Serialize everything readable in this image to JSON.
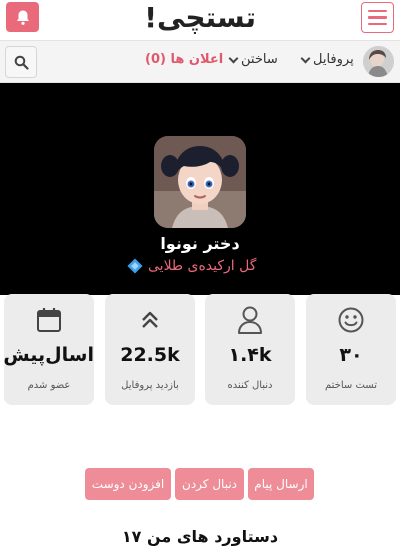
{
  "header": {
    "logo_text": "تستچی!",
    "bell_icon": "bell-icon",
    "menu_icon": "hamburger-icon",
    "accent_color": "#e96a7b"
  },
  "nav": {
    "profile_label": "پروفایل",
    "build_label": "ساختن",
    "notifications_label": "اعلان ها (0)",
    "search_icon": "search-icon"
  },
  "profile": {
    "name": "دختر نونوا",
    "rank": "گل ارکیده‌ی طلایی",
    "rank_icon": "diamond-icon"
  },
  "stats": [
    {
      "value": "اسال‌پیش",
      "label": "عضو شدم",
      "icon": "calendar-icon"
    },
    {
      "value": "22.5k",
      "label": "بازدید پروفایل",
      "icon": "double-chevron-up-icon"
    },
    {
      "value": "۱.۴k",
      "label": "دنبال کننده",
      "icon": "user-icon"
    },
    {
      "value": "۳۰",
      "label": "تست ساختم",
      "icon": "smiley-icon"
    }
  ],
  "actions": {
    "add_friend": "افزودن دوست",
    "follow": "دنبال کردن",
    "message": "ارسال پیام"
  },
  "achievements": {
    "title": "دستاورد های من ۱۷"
  }
}
